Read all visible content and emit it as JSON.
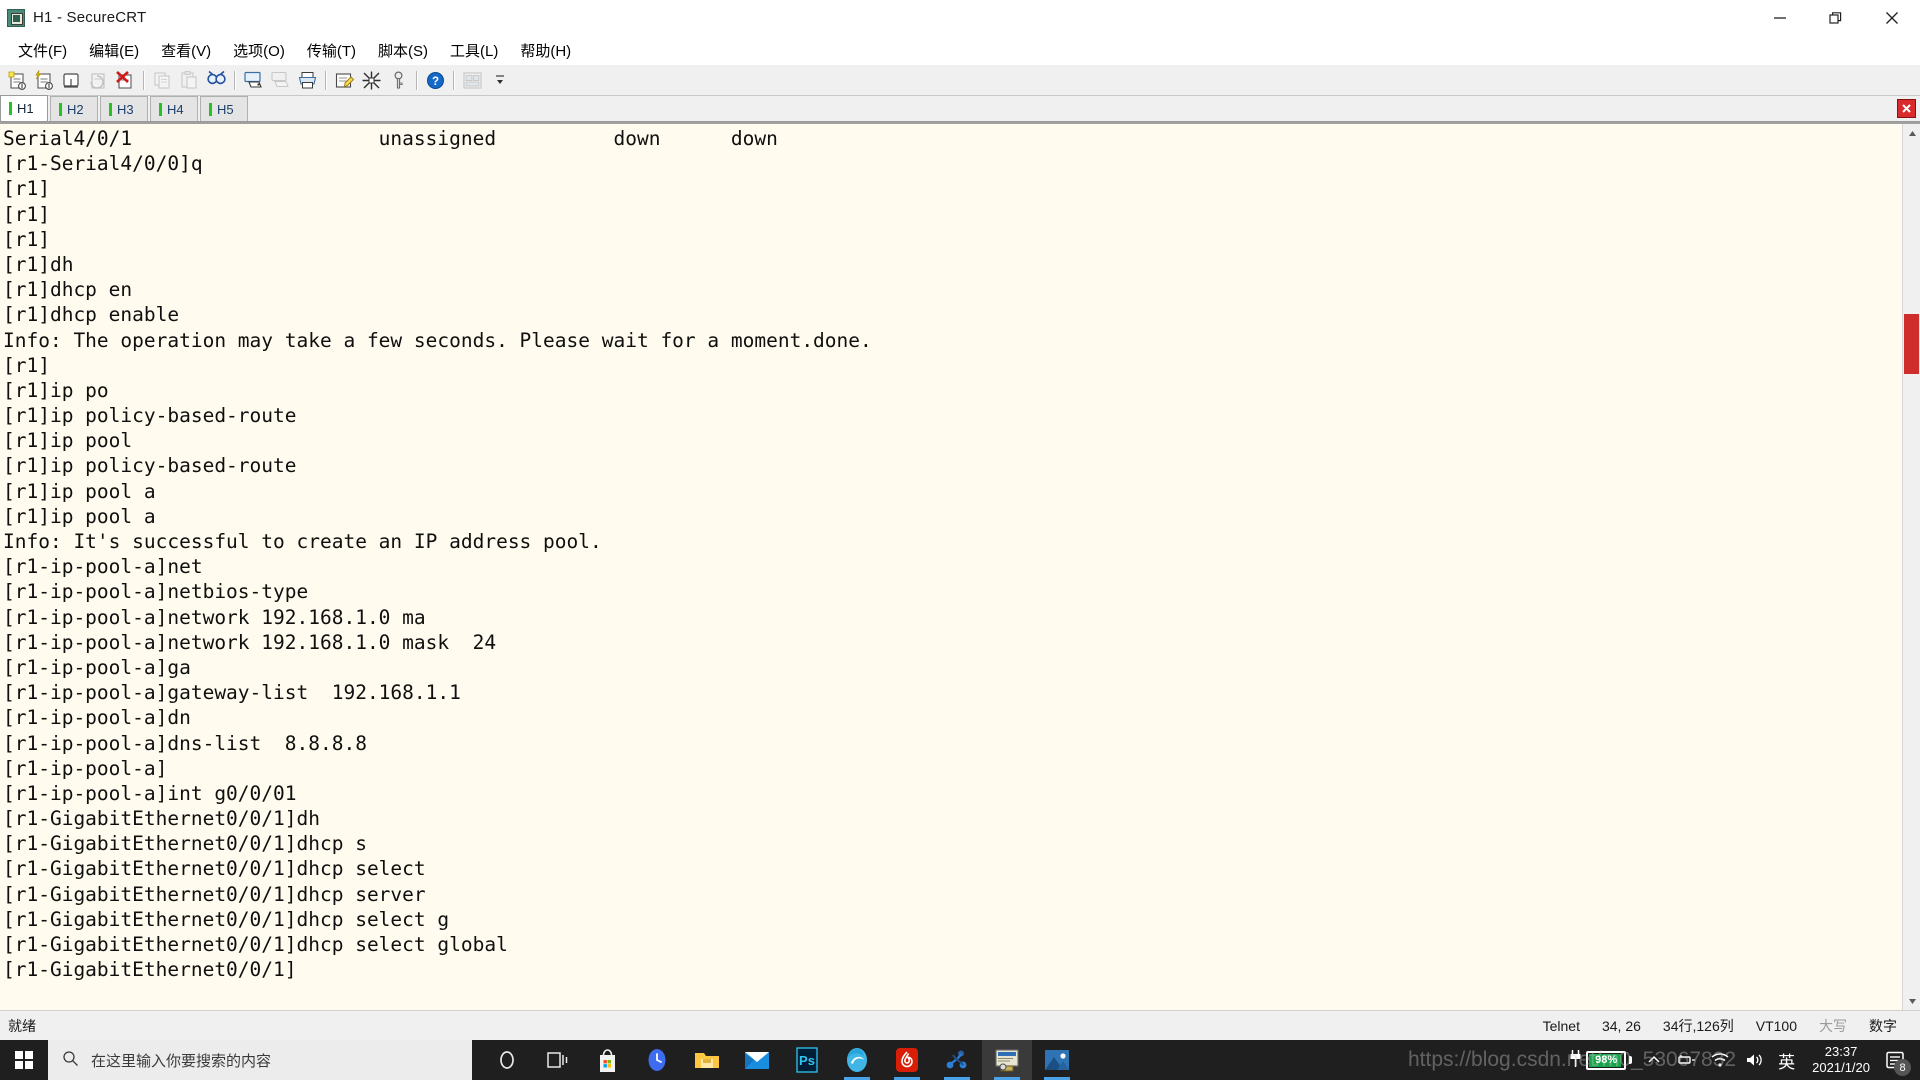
{
  "window": {
    "title": "H1 - SecureCRT",
    "app_icon": "securecrt-icon",
    "minimize": "—",
    "maximize": "❐",
    "close": "✕"
  },
  "menubar": {
    "items": [
      {
        "label": "文件(F)",
        "name": "menu-file"
      },
      {
        "label": "编辑(E)",
        "name": "menu-edit"
      },
      {
        "label": "查看(V)",
        "name": "menu-view"
      },
      {
        "label": "选项(O)",
        "name": "menu-options"
      },
      {
        "label": "传输(T)",
        "name": "menu-transfer"
      },
      {
        "label": "脚本(S)",
        "name": "menu-script"
      },
      {
        "label": "工具(L)",
        "name": "menu-tools"
      },
      {
        "label": "帮助(H)",
        "name": "menu-help"
      }
    ]
  },
  "toolbar": {
    "buttons": [
      {
        "name": "new-session-icon",
        "glyph": "❐"
      },
      {
        "name": "connect-icon",
        "glyph": "⚡"
      },
      {
        "name": "connect-local-shell-icon",
        "glyph": "▭"
      },
      {
        "name": "reconnect-icon",
        "glyph": "↻"
      },
      {
        "name": "disconnect-icon",
        "glyph": "✖"
      },
      {
        "name": "copy-icon",
        "glyph": "⧉"
      },
      {
        "name": "paste-icon",
        "glyph": "Ὄb"
      },
      {
        "name": "find-icon",
        "glyph": "⌕"
      },
      {
        "name": "print-screen-icon",
        "glyph": "⎙"
      },
      {
        "name": "log-session-icon",
        "glyph": "⎘"
      },
      {
        "name": "print-icon",
        "glyph": "⎙"
      },
      {
        "name": "session-options-icon",
        "glyph": "⚙"
      },
      {
        "name": "global-options-icon",
        "glyph": "⚒"
      },
      {
        "name": "key-icon",
        "glyph": "⚿"
      },
      {
        "name": "help-icon",
        "glyph": "?"
      },
      {
        "name": "arrange-windows-icon",
        "glyph": "▣"
      }
    ]
  },
  "tabs": {
    "items": [
      {
        "label": "H1",
        "active": true
      },
      {
        "label": "H2",
        "active": false
      },
      {
        "label": "H3",
        "active": false
      },
      {
        "label": "H4",
        "active": false
      },
      {
        "label": "H5",
        "active": false
      }
    ],
    "close_glyph": "✕"
  },
  "terminal": {
    "lines": [
      "Serial4/0/1                     unassigned          down      down",
      "[r1-Serial4/0/0]q",
      "[r1]",
      "[r1]",
      "[r1]",
      "[r1]dh",
      "[r1]dhcp en",
      "[r1]dhcp enable",
      "Info: The operation may take a few seconds. Please wait for a moment.done.",
      "[r1]",
      "[r1]ip po",
      "[r1]ip policy-based-route",
      "[r1]ip pool",
      "[r1]ip policy-based-route",
      "[r1]ip pool a",
      "[r1]ip pool a",
      "Info: It's successful to create an IP address pool.",
      "[r1-ip-pool-a]net",
      "[r1-ip-pool-a]netbios-type",
      "[r1-ip-pool-a]network 192.168.1.0 ma",
      "[r1-ip-pool-a]network 192.168.1.0 mask  24",
      "[r1-ip-pool-a]ga",
      "[r1-ip-pool-a]gateway-list  192.168.1.1",
      "[r1-ip-pool-a]dn",
      "[r1-ip-pool-a]dns-list  8.8.8.8",
      "[r1-ip-pool-a]",
      "[r1-ip-pool-a]int g0/0/01",
      "[r1-GigabitEthernet0/0/1]dh",
      "[r1-GigabitEthernet0/0/1]dhcp s",
      "[r1-GigabitEthernet0/0/1]dhcp select",
      "[r1-GigabitEthernet0/0/1]dhcp server",
      "[r1-GigabitEthernet0/0/1]dhcp select g",
      "[r1-GigabitEthernet0/0/1]dhcp select global",
      "[r1-GigabitEthernet0/0/1]"
    ],
    "background": "#fffbee",
    "foreground": "#0f0f0f"
  },
  "scrollbar": {
    "up_arrow": "▲",
    "down_arrow": "▼",
    "thumb_color": "#cf2c2c"
  },
  "statusbar": {
    "ready": "就绪",
    "protocol": "Telnet",
    "cursor": "34, 26",
    "size": "34行,126列",
    "emulation": "VT100",
    "caps": "大写",
    "num": "数字"
  },
  "taskbar": {
    "start": "start-button",
    "search_placeholder": "在这里输入你要搜索的内容",
    "search_icon": "search-icon",
    "pinned": [
      {
        "name": "taskbar-cortana",
        "glyph": "◯",
        "kind": "cortana",
        "active": false,
        "running": false
      },
      {
        "name": "taskbar-task-view",
        "glyph": "⌸",
        "kind": "taskview",
        "active": false,
        "running": false
      },
      {
        "name": "taskbar-microsoft-store",
        "glyph": "",
        "kind": "store",
        "active": false,
        "running": false
      },
      {
        "name": "taskbar-clock-app",
        "glyph": "",
        "kind": "clockapp",
        "active": false,
        "running": false
      },
      {
        "name": "taskbar-file-explorer",
        "glyph": "",
        "kind": "explorer",
        "active": false,
        "running": false
      },
      {
        "name": "taskbar-mail",
        "glyph": "",
        "kind": "mail",
        "active": false,
        "running": false
      },
      {
        "name": "taskbar-photoshop",
        "glyph": "Ps",
        "kind": "photoshop",
        "active": false,
        "running": false
      },
      {
        "name": "taskbar-microsoft-edge",
        "glyph": "e",
        "kind": "edge",
        "active": false,
        "running": true
      },
      {
        "name": "taskbar-netease-music",
        "glyph": "❁",
        "kind": "netease",
        "active": false,
        "running": true
      },
      {
        "name": "taskbar-ensp",
        "glyph": "",
        "kind": "ensp",
        "active": false,
        "running": true
      },
      {
        "name": "taskbar-securecrt",
        "glyph": "",
        "kind": "securecrt",
        "active": true,
        "running": true
      },
      {
        "name": "taskbar-photos",
        "glyph": "",
        "kind": "photos",
        "active": false,
        "running": true
      }
    ],
    "tray": {
      "battery_percent": "98%",
      "chevron": "∧",
      "network_icon": "network-icon",
      "wifi_icon": "wifi-icon",
      "volume_icon": "volume-icon",
      "ime": "英",
      "time": "23:37",
      "date": "2021/1/20",
      "notification_count": "8"
    }
  },
  "watermark": {
    "text": "https://blog.csdn.net/m0_53067832"
  }
}
